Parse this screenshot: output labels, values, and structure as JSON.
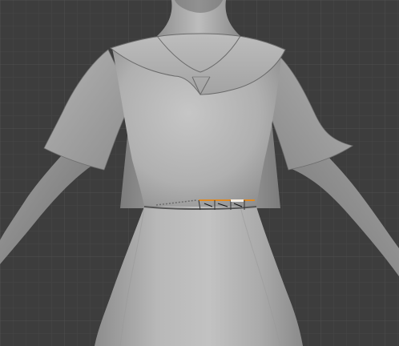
{
  "viewport": {
    "background_color": "#3d3d3d",
    "grid_color": "#4a4a4a",
    "grid_major_color": "#525252"
  },
  "scene": {
    "object": "mannequin-in-dress",
    "body_color": "#a9a9a9",
    "dress_color": "#b3b3b3",
    "dress_shadow_color": "#8c8c8c",
    "seam_color": "#555555",
    "selection_color": "#e08a22",
    "selected_edge_color": "#ffffff"
  }
}
